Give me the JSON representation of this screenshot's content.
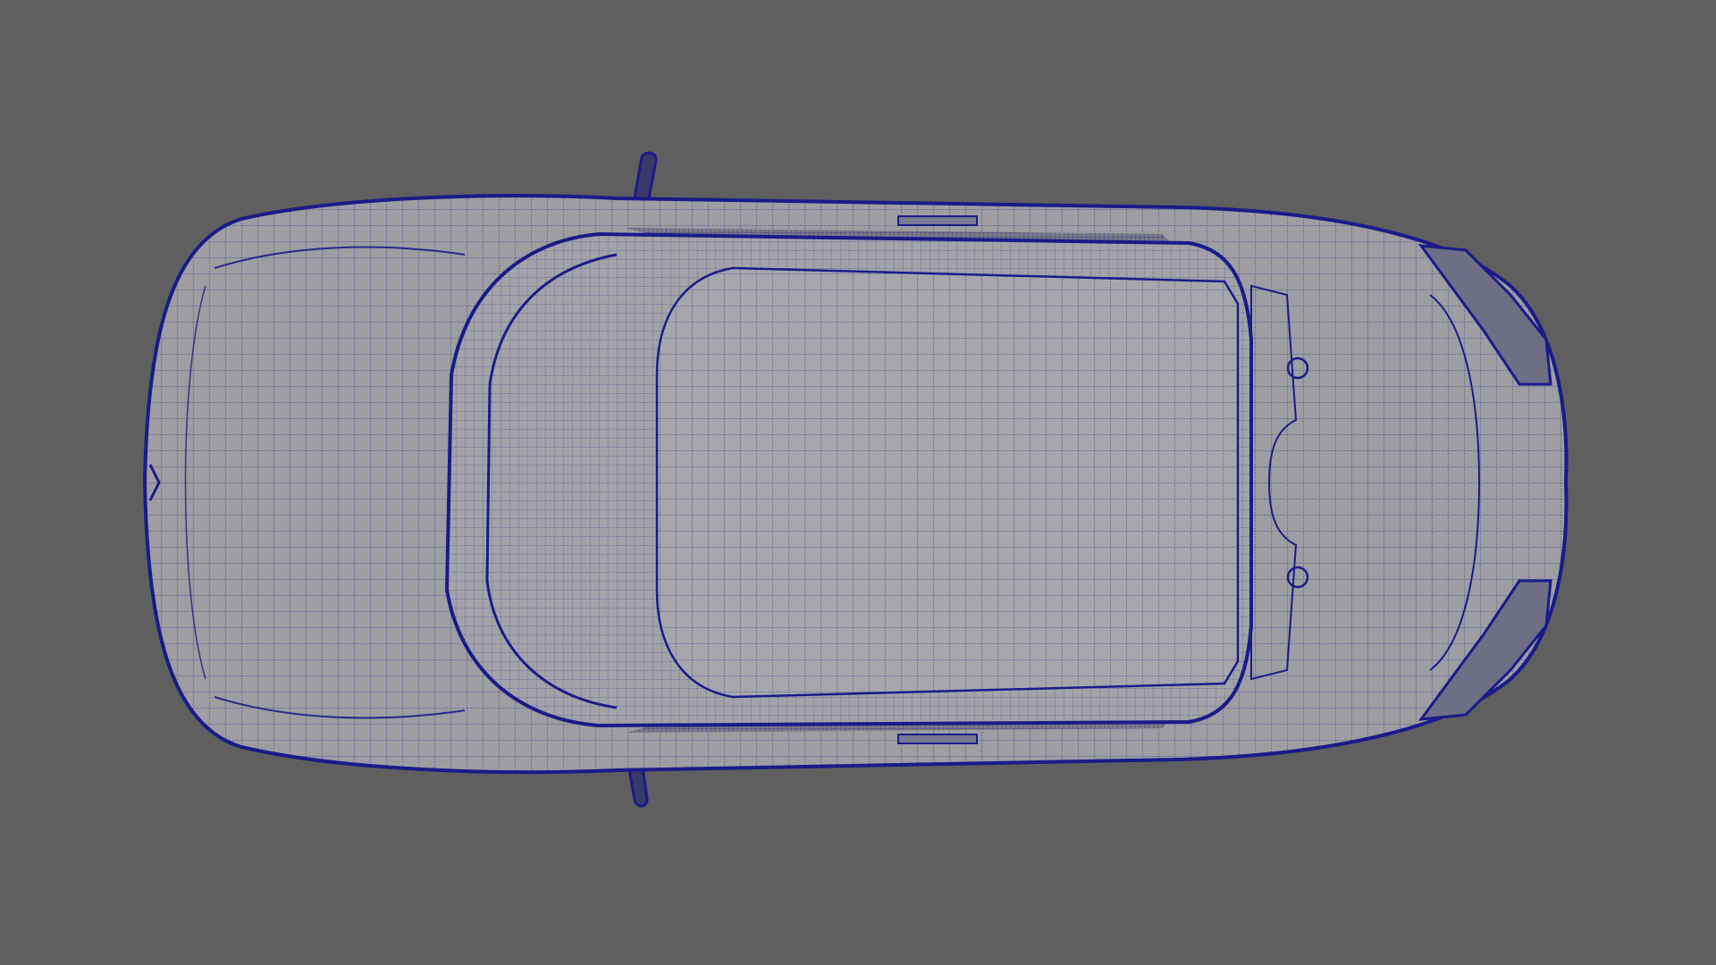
{
  "viewport": {
    "background_color": "#5f5f5f",
    "view": "top",
    "display_mode": "wireframe-on-shaded"
  },
  "model": {
    "object": "car",
    "surface_color": "#9d9da2",
    "wireframe_color": "#1a1a8a"
  }
}
